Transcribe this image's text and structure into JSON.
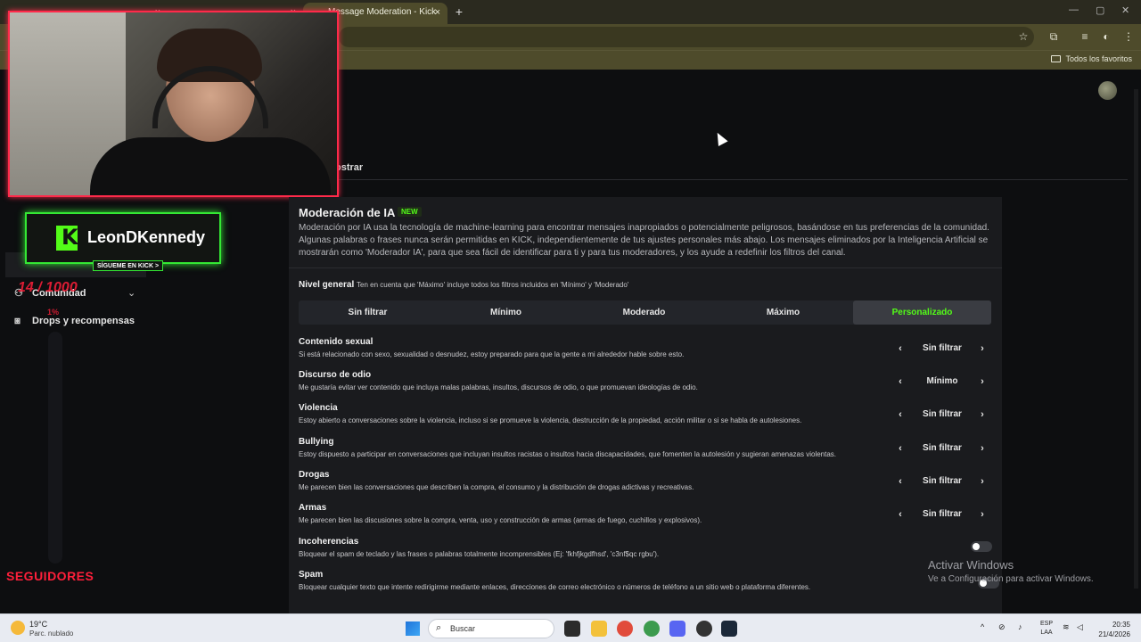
{
  "browser": {
    "tabs": [
      {
        "label": "",
        "active": false
      },
      {
        "label": "",
        "active": false
      },
      {
        "label": "Message Moderation - Kick Da",
        "active": true
      }
    ],
    "new_tab": "+",
    "bookmarks_folder": "Todos los favoritos"
  },
  "page": {
    "partial_heading": "ostrar"
  },
  "overlay": {
    "channel_name": "LeonDKennedy",
    "follow_cta": "SÍGUEME EN KICK >",
    "goal": "14 / 1000",
    "goal_pct": "1%",
    "goal_progress": 0.014,
    "goal_label": "SEGUIDORES"
  },
  "sidebar": {
    "items": [
      {
        "label": "Comunidad",
        "icon": "users-icon"
      },
      {
        "label": "Drops y recompensas",
        "icon": "gift-icon"
      }
    ]
  },
  "moderation": {
    "title": "Moderación de IA",
    "badge": "NEW",
    "description": "Moderación por IA usa la tecnología de machine-learning para encontrar mensajes inapropiados o potencialmente peligrosos, basándose en tus preferencias de la comunidad. Algunas palabras o frases nunca serán permitidas en KICK, independientemente de tus ajustes personales más abajo. Los mensajes eliminados por la Inteligencia Artificial se mostrarán como 'Moderador IA', para que sea fácil de identificar para ti y para tus moderadores, y los ayude a redefinir los filtros del canal.",
    "nivel_title": "Nivel general",
    "nivel_note": "Ten en cuenta que 'Máximo' incluye todos los filtros incluidos en 'Mínimo' y 'Moderado'",
    "levels": [
      "Sin filtrar",
      "Mínimo",
      "Moderado",
      "Máximo",
      "Personalizado"
    ],
    "selected_level": "Personalizado",
    "categories": [
      {
        "title": "Contenido sexual",
        "desc": "Si está relacionado con sexo, sexualidad o desnudez, estoy preparado para que la gente a mi alrededor hable sobre esto.",
        "value": "Sin filtrar"
      },
      {
        "title": "Discurso de odio",
        "desc": "Me gustaría evitar ver contenido que incluya malas palabras, insultos, discursos de odio, o que promuevan ideologías de odio.",
        "value": "Mínimo"
      },
      {
        "title": "Violencia",
        "desc": "Estoy abierto a conversaciones sobre la violencia, incluso si se promueve la violencia, destrucción de la propiedad, acción militar o si se habla de autolesiones.",
        "value": "Sin filtrar"
      },
      {
        "title": "Bullying",
        "desc": "Estoy dispuesto a participar en conversaciones que incluyan insultos racistas o insultos hacia discapacidades, que fomenten la autolesión y sugieran amenazas violentas.",
        "value": "Sin filtrar"
      },
      {
        "title": "Drogas",
        "desc": "Me parecen bien las conversaciones que describen la compra, el consumo y la distribución de drogas adictivas y recreativas.",
        "value": "Sin filtrar"
      },
      {
        "title": "Armas",
        "desc": "Me parecen bien las discusiones sobre la compra, venta, uso y construcción de armas (armas de fuego, cuchillos y explosivos).",
        "value": "Sin filtrar"
      }
    ],
    "toggles": [
      {
        "title": "Incoherencias",
        "desc": "Bloquear el spam de teclado y las frases o palabras totalmente incomprensibles (Ej: 'fkhfjkgdfhsd', 'c3nf$qc rgbu').",
        "enabled": false
      },
      {
        "title": "Spam",
        "desc": "Bloquear cualquier texto que intente redirigirme mediante enlaces, direcciones de correo electrónico o números de teléfono a un sitio web o plataforma diferentes.",
        "enabled": false
      }
    ]
  },
  "watermark": {
    "line1": "Activar Windows",
    "line2": "Ve a Configuración para activar Windows."
  },
  "taskbar": {
    "temp": "19°C",
    "weather": "Parc. nublado",
    "search_label": "Buscar",
    "lang1": "ESP",
    "lang2": "LAA",
    "time": "20:35",
    "date": "21/4/2026"
  }
}
